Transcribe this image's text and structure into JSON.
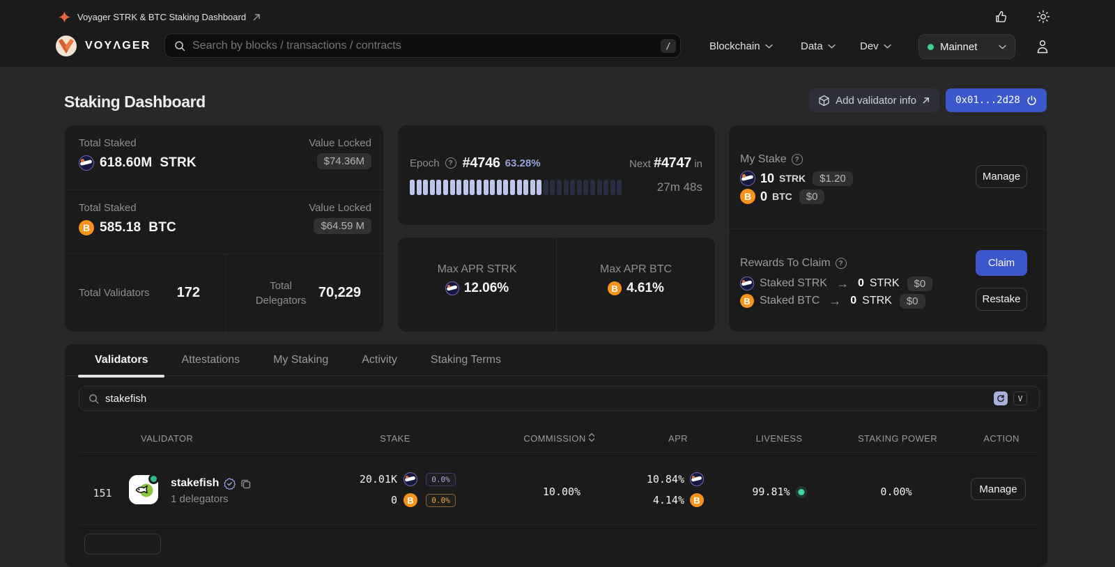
{
  "meta_bar": {
    "title": "Voyager STRK & BTC Staking Dashboard"
  },
  "nav": {
    "brand": "VOYΛGER",
    "search_placeholder": "Search by blocks / transactions / contracts",
    "search_shortcut": "/",
    "menus": [
      {
        "label": "Blockchain"
      },
      {
        "label": "Data"
      },
      {
        "label": "Dev"
      }
    ],
    "network": "Mainnet"
  },
  "page_header": {
    "title": "Staking Dashboard",
    "add_validator_label": "Add validator info",
    "wallet_address": "0x01...2d28"
  },
  "stats": {
    "strk": {
      "label": "Total Staked",
      "amount": "618.60M",
      "unit": "STRK",
      "value_locked_label": "Value Locked",
      "value_locked": "$74.36M"
    },
    "btc": {
      "label": "Total Staked",
      "amount": "585.18",
      "unit": "BTC",
      "value_locked_label": "Value Locked",
      "value_locked": "$64.59 M"
    },
    "validators": {
      "label": "Total Validators",
      "value": "172"
    },
    "delegators": {
      "label": "Total Delegators",
      "value": "70,229"
    }
  },
  "epoch": {
    "label": "Epoch",
    "current": "#4746",
    "progress_pct": "63.28%",
    "next_label": "Next",
    "next": "#4747",
    "in_label": "in",
    "remaining": "27m 48s",
    "segments_total": 32,
    "segments_filled": 20
  },
  "apr": {
    "strk_label": "Max APR STRK",
    "strk": "12.06%",
    "btc_label": "Max APR BTC",
    "btc": "4.61%"
  },
  "my_stake": {
    "label": "My Stake",
    "strk_amount": "10",
    "strk_unit": "STRK",
    "strk_value": "$1.20",
    "btc_amount": "0",
    "btc_unit": "BTC",
    "btc_value": "$0",
    "manage_label": "Manage"
  },
  "rewards": {
    "label": "Rewards To Claim",
    "rows": [
      {
        "name": "Staked STRK",
        "amount": "0",
        "unit": "STRK",
        "value": "$0"
      },
      {
        "name": "Staked BTC",
        "amount": "0",
        "unit": "STRK",
        "value": "$0"
      }
    ],
    "claim_label": "Claim",
    "restake_label": "Restake"
  },
  "tabs": [
    "Validators",
    "Attestations",
    "My Staking",
    "Activity",
    "Staking Terms"
  ],
  "validators_table": {
    "search_value": "stakefish",
    "shortcut_key": "V",
    "columns": [
      "VALIDATOR",
      "STAKE",
      "COMMISSION",
      "APR",
      "LIVENESS",
      "STAKING POWER",
      "ACTION"
    ],
    "rows": [
      {
        "rank": "151",
        "name": "stakefish",
        "delegators": "1 delegators",
        "stake_strk": "20.01K",
        "stake_strk_pct": "0.0%",
        "stake_btc": "0",
        "stake_btc_pct": "0.0%",
        "commission": "10.00%",
        "apr_strk": "10.84%",
        "apr_btc": "4.14%",
        "liveness": "99.81%",
        "staking_power": "0.00%",
        "action": "Manage"
      }
    ]
  }
}
